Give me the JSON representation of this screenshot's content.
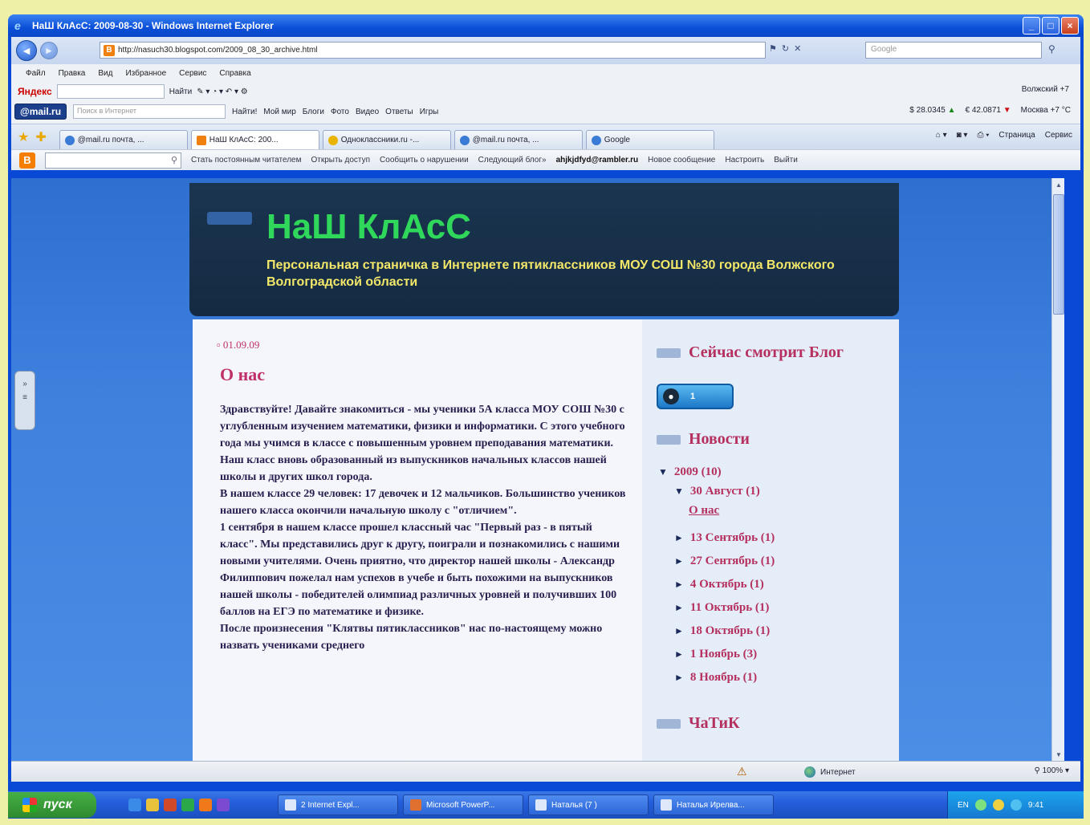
{
  "window": {
    "title": "НаШ КлАсС: 2009-08-30 - Windows Internet Explorer",
    "controls": [
      "_",
      "□",
      "×"
    ]
  },
  "address_bar": {
    "url": "http://nasuch30.blogspot.com/2009_08_30_archive.html",
    "search_placeholder": "Google"
  },
  "menu": [
    "Файл",
    "Правка",
    "Вид",
    "Избранное",
    "Сервис",
    "Справка"
  ],
  "yandex_toolbar": {
    "logo": "Яндекс",
    "button": "Найти",
    "right_text": "Волжский  +7"
  },
  "mail_toolbar": {
    "logo": "@mail.ru",
    "input_placeholder": "Поиск в Интернет",
    "search_btn": "Найти!",
    "items": [
      "Мой мир",
      "Блоги",
      "Фото",
      "Видео",
      "Ответы",
      "Игры"
    ],
    "usd": "$ 28.0345",
    "eur": "€ 42.0871",
    "weather": "Москва +7 °C"
  },
  "tabs": [
    {
      "label": "@mail.ru почта, ...",
      "active": false,
      "icon": "mail-icon"
    },
    {
      "label": "НаШ КлАсС: 200...",
      "active": true,
      "icon": "blogger-icon"
    },
    {
      "label": "Одноклассники.ru -...",
      "active": false,
      "icon": "ok-icon"
    },
    {
      "label": "@mail.ru почта, ...",
      "active": false,
      "icon": "mail-icon"
    },
    {
      "label": "Google",
      "active": false,
      "icon": "google-icon"
    }
  ],
  "tab_tools": [
    "Страница",
    "Сервис"
  ],
  "blogger_nav": {
    "links": [
      "Стать постоянным читателем",
      "Открыть доступ",
      "Сообщить о нарушении",
      "Следующий блог»"
    ],
    "user": "ahjkjdfyd@rambler.ru",
    "right_links": [
      "Новое сообщение",
      "Настроить",
      "Выйти"
    ]
  },
  "blog": {
    "title": "НаШ КлАсС",
    "description": "Персональная страничка в Интернете пятиклассников МОУ СОШ №30 города Волжского Волгоградской области"
  },
  "post": {
    "date": "01.09.09",
    "title": "О нас",
    "paragraphs": [
      "Здравствуйте! Давайте знакомиться - мы ученики 5А класса МОУ СОШ №30 с углубленным изучением математики, физики и информатики. С этого учебного года мы учимся в классе с повышенным уровнем преподавания математики. Наш класс вновь образованный из выпускников начальных классов нашей школы и других школ города.",
      "В нашем классе 29 человек: 17 девочек и 12 мальчиков. Большинство учеников нашего класса окончили начальную школу с \"отличием\".",
      "1 сентября в нашем классе прошел классный час \"Первый раз - в пятый класс\". Мы представились друг к другу, поиграли и познакомились с нашими новыми учителями. Очень приятно, что директор нашей школы - Александр Филиппович пожелал нам успехов в учебе и быть похожими на выпускников нашей школы - победителей олимпиад различных уровней и получивших 100 баллов на ЕГЭ по математике и физике.",
      "После произнесения \"Клятвы пятиклассников\" нас по-настоящему можно назвать учениками среднего"
    ]
  },
  "sidebar": {
    "viewers_title": "Сейчас смотрит Блог",
    "viewers_count": "1",
    "news_title": "Новости",
    "archive": {
      "year": "2009 (10)",
      "month": "30 Август (1)",
      "post": "О нас",
      "items": [
        "13 Сентябрь (1)",
        "27 Сентябрь (1)",
        "4 Октябрь (1)",
        "11 Октябрь (1)",
        "18 Октябрь (1)",
        "1 Ноябрь (3)",
        "8 Ноябрь (1)"
      ]
    },
    "chat_title": "ЧаТиК"
  },
  "statusbar": {
    "zone": "Интернет",
    "zoom": "100%"
  },
  "taskbar": {
    "start": "пуск",
    "tasks": [
      "2 Internet Expl...",
      "Microsoft PowerP...",
      "Наталья (7 )",
      "Наталья Ирелва..."
    ],
    "lang": "EN",
    "time": "9:41"
  }
}
